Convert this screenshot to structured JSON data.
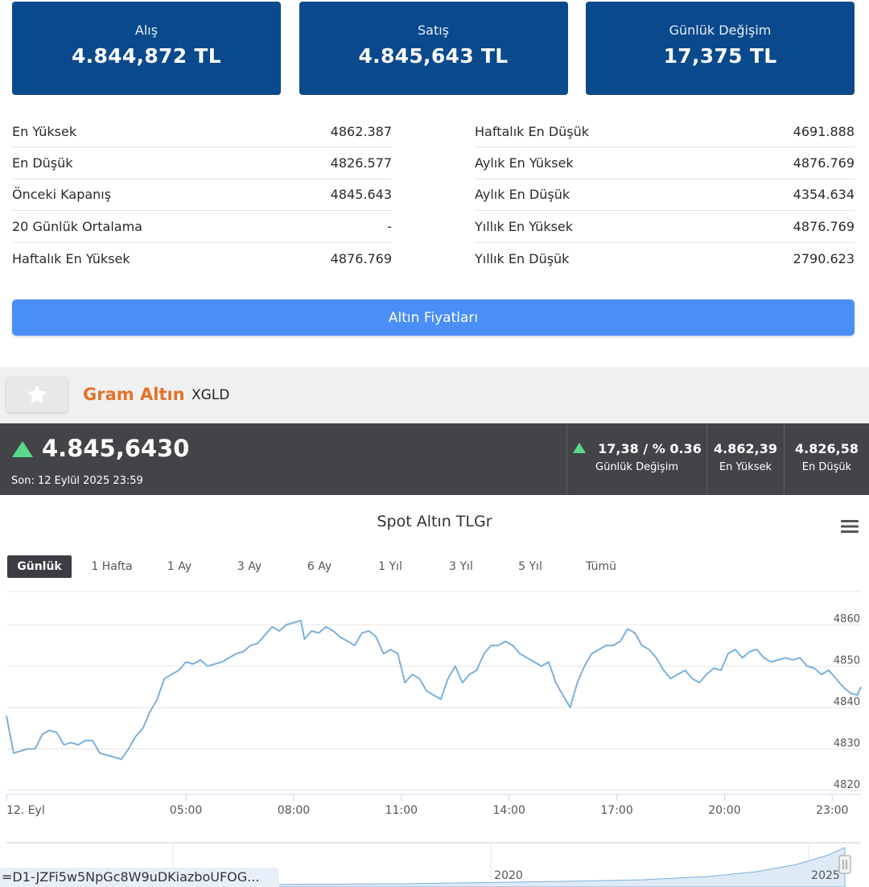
{
  "cards": [
    {
      "label": "Alış",
      "value": "4.844,872 TL"
    },
    {
      "label": "Satış",
      "value": "4.845,643 TL"
    },
    {
      "label": "Günlük Değişim",
      "value": "17,375 TL"
    }
  ],
  "stats_left": [
    {
      "label": "En Yüksek",
      "value": "4862.387"
    },
    {
      "label": "En Düşük",
      "value": "4826.577"
    },
    {
      "label": "Önceki Kapanış",
      "value": "4845.643"
    },
    {
      "label": "20 Günlük Ortalama",
      "value": "-"
    },
    {
      "label": "Haftalık En Yüksek",
      "value": "4876.769"
    }
  ],
  "stats_right": [
    {
      "label": "Haftalık En Düşük",
      "value": "4691.888"
    },
    {
      "label": "Aylık En Yüksek",
      "value": "4876.769"
    },
    {
      "label": "Aylık En Düşük",
      "value": "4354.634"
    },
    {
      "label": "Yıllık En Yüksek",
      "value": "4876.769"
    },
    {
      "label": "Yıllık En Düşük",
      "value": "2790.623"
    }
  ],
  "gold_prices_button": "Altın Fiyatları",
  "asset": {
    "name": "Gram Altın",
    "code": "XGLD"
  },
  "quote": {
    "price": "4.845,6430",
    "last_update": "Son: 12 Eylül 2025 23:59",
    "change_value": "17,38 / % 0.36",
    "change_label": "Günlük Değişim",
    "high_value": "4.862,39",
    "high_label": "En Yüksek",
    "low_value": "4.826,58",
    "low_label": "En Düşük",
    "up_color": "#59d98a"
  },
  "chart_title": "Spot Altın TLGr",
  "range_buttons": [
    "Günlük",
    "1 Hafta",
    "1 Ay",
    "3 Ay",
    "6 Ay",
    "1 Yıl",
    "3 Yıl",
    "5 Yıl",
    "Tümü"
  ],
  "active_range": "Günlük",
  "navigator_labels": [
    "2020",
    "2025"
  ],
  "tooltip_text": "=D1-JZFi5w5NpGc8W9uDKiazboUFOG...",
  "chart_data": {
    "type": "line",
    "title": "Spot Altın TLGr",
    "x_tick_labels": [
      "12. Eyl",
      "05:00",
      "08:00",
      "11:00",
      "14:00",
      "17:00",
      "20:00",
      "23:00"
    ],
    "x_tick_hours": [
      0,
      5,
      8,
      11,
      14,
      17,
      20,
      23
    ],
    "x_range_hours": [
      0,
      23.8
    ],
    "y_ticks": [
      4820,
      4830,
      4840,
      4850,
      4860
    ],
    "ylim": [
      4820,
      4862
    ],
    "grid": true,
    "line_color": "#7cb0dc",
    "x": [
      0,
      0.2,
      0.4,
      0.6,
      0.8,
      1.0,
      1.2,
      1.4,
      1.6,
      1.8,
      2.0,
      2.2,
      2.4,
      2.6,
      2.8,
      3.0,
      3.2,
      3.4,
      3.6,
      3.8,
      4.0,
      4.2,
      4.4,
      4.6,
      4.8,
      5.0,
      5.2,
      5.4,
      5.6,
      5.8,
      6.0,
      6.2,
      6.4,
      6.6,
      6.8,
      7.0,
      7.2,
      7.4,
      7.6,
      7.8,
      8.0,
      8.2,
      8.3,
      8.5,
      8.7,
      8.9,
      9.1,
      9.3,
      9.5,
      9.7,
      9.9,
      10.1,
      10.3,
      10.5,
      10.7,
      10.9,
      11.1,
      11.3,
      11.5,
      11.7,
      11.9,
      12.1,
      12.3,
      12.5,
      12.7,
      12.9,
      13.1,
      13.3,
      13.5,
      13.7,
      13.9,
      14.1,
      14.3,
      14.5,
      14.7,
      14.9,
      15.1,
      15.3,
      15.5,
      15.7,
      15.9,
      16.1,
      16.3,
      16.5,
      16.7,
      16.9,
      17.1,
      17.3,
      17.5,
      17.7,
      17.9,
      18.1,
      18.3,
      18.5,
      18.7,
      18.9,
      19.1,
      19.3,
      19.5,
      19.7,
      19.9,
      20.1,
      20.3,
      20.5,
      20.7,
      20.9,
      21.1,
      21.3,
      21.5,
      21.7,
      21.9,
      22.1,
      22.3,
      22.5,
      22.7,
      22.9,
      23.1,
      23.3,
      23.5,
      23.7,
      23.8
    ],
    "y": [
      4838,
      4829,
      4829.5,
      4830,
      4830,
      4833.5,
      4834.5,
      4834,
      4831,
      4831.5,
      4831,
      4832,
      4832,
      4829,
      4828.5,
      4828,
      4827.5,
      4830,
      4833,
      4835,
      4839,
      4842,
      4847,
      4848,
      4849,
      4851,
      4850.5,
      4851.5,
      4850,
      4850.5,
      4851,
      4852,
      4853,
      4853.5,
      4855,
      4855.5,
      4857.5,
      4859.5,
      4858.5,
      4860,
      4860.5,
      4861,
      4856.5,
      4858.5,
      4858,
      4859.5,
      4858.5,
      4857,
      4856,
      4855,
      4858,
      4858.5,
      4857,
      4853,
      4854,
      4853,
      4846,
      4848,
      4847,
      4844,
      4843,
      4842,
      4847,
      4850,
      4846,
      4848,
      4849,
      4853,
      4855,
      4855,
      4856,
      4855,
      4853,
      4852,
      4851,
      4850,
      4851,
      4846,
      4843,
      4840,
      4846,
      4850,
      4853,
      4854,
      4855,
      4855,
      4856,
      4859,
      4858,
      4855,
      4854,
      4852,
      4849,
      4847,
      4848,
      4849,
      4847,
      4846,
      4848,
      4849.5,
      4849,
      4853,
      4854,
      4852,
      4853.5,
      4854,
      4852,
      4851,
      4851.5,
      4852,
      4851.5,
      4852,
      4850,
      4849.5,
      4848,
      4849,
      4847,
      4845,
      4843.5,
      4843,
      4845
    ]
  }
}
